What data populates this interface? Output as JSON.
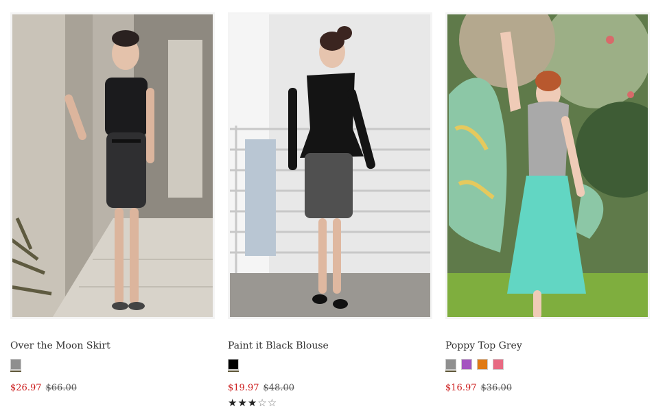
{
  "products": [
    {
      "name": "Over the Moon Skirt",
      "image_alt": "model in black top and leather pencil skirt",
      "swatches": [
        {
          "color": "#8f8f8f",
          "selected": true
        }
      ],
      "sale_price": "$26.97",
      "original_price": "$66.00",
      "rating": null
    },
    {
      "name": "Paint it Black Blouse",
      "image_alt": "model in black peplum blouse and tweed skirt",
      "swatches": [
        {
          "color": "#000000",
          "selected": true
        }
      ],
      "sale_price": "$19.97",
      "original_price": "$48.00",
      "rating": {
        "filled": "★★★",
        "empty": "☆☆"
      }
    },
    {
      "name": "Poppy Top Grey",
      "image_alt": "model in grey top with floral scarf and aqua skirt",
      "swatches": [
        {
          "color": "#8f8f8f",
          "selected": true
        },
        {
          "color": "#a453c0",
          "selected": false
        },
        {
          "color": "#e07a14",
          "selected": false
        },
        {
          "color": "#e86a82",
          "selected": false
        }
      ],
      "sale_price": "$16.97",
      "original_price": "$36.00",
      "rating": null
    }
  ]
}
